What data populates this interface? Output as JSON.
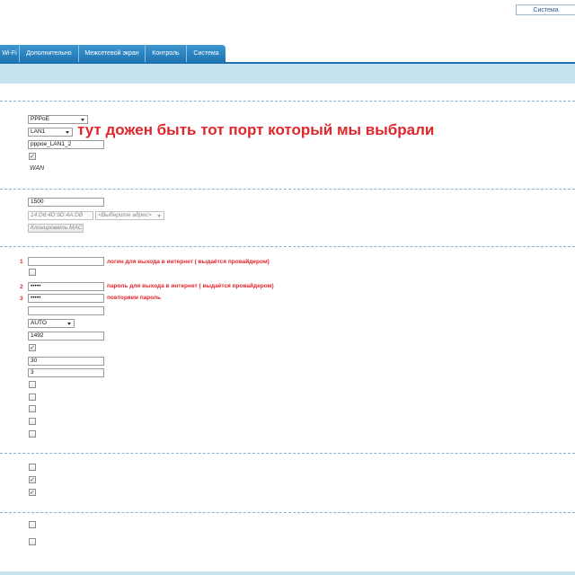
{
  "header": {
    "system_menu_label": "Система"
  },
  "nav": {
    "tabs": [
      {
        "label": "Wi-Fi"
      },
      {
        "label": "Дополнительно"
      },
      {
        "label": "Межсетевой экран"
      },
      {
        "label": "Контроль"
      },
      {
        "label": "Система"
      }
    ]
  },
  "connection": {
    "type_value": "PPPoE",
    "port_value": "LAN1",
    "name_value": "pppoe_LAN1_2",
    "enable_checked": true,
    "direction_label": "WAN",
    "port_annotation": "тут дожен быть тот порт который мы выбрали"
  },
  "ethernet": {
    "mtu_value": "1500",
    "mac_value": "14:D6:4D:9D:4A:DB",
    "mac_select_placeholder": "<Выберите адрес>",
    "clone_mac_label": "Клонировать MAC"
  },
  "ppp": {
    "login_value": "",
    "login_number": "1",
    "login_note": "логин для выхода в интернет ( выдаётся провайдером)",
    "no_auth_checked": false,
    "password_value": "•••••",
    "password_number": "2",
    "password_note": "пароль для выхода в интернет ( выдаётся провайдером)",
    "password_confirm_value": "•••••",
    "password_confirm_number": "3",
    "password_confirm_note": "повторяем пароль",
    "service_name_value": "",
    "auth_algorithm_value": "AUTO",
    "mtu_value": "1492",
    "keep_alive_checked": true,
    "lcp_interval_value": "30",
    "lcp_fails_value": "3",
    "extra_checkboxes": [
      {
        "checked": false
      },
      {
        "checked": false
      },
      {
        "checked": false
      },
      {
        "checked": false
      },
      {
        "checked": false
      }
    ]
  },
  "misc": {
    "checkboxes": [
      {
        "checked": false
      },
      {
        "checked": true
      },
      {
        "checked": true
      }
    ]
  },
  "final": {
    "checkboxes": [
      {
        "checked": false
      },
      {
        "checked": false
      }
    ]
  }
}
